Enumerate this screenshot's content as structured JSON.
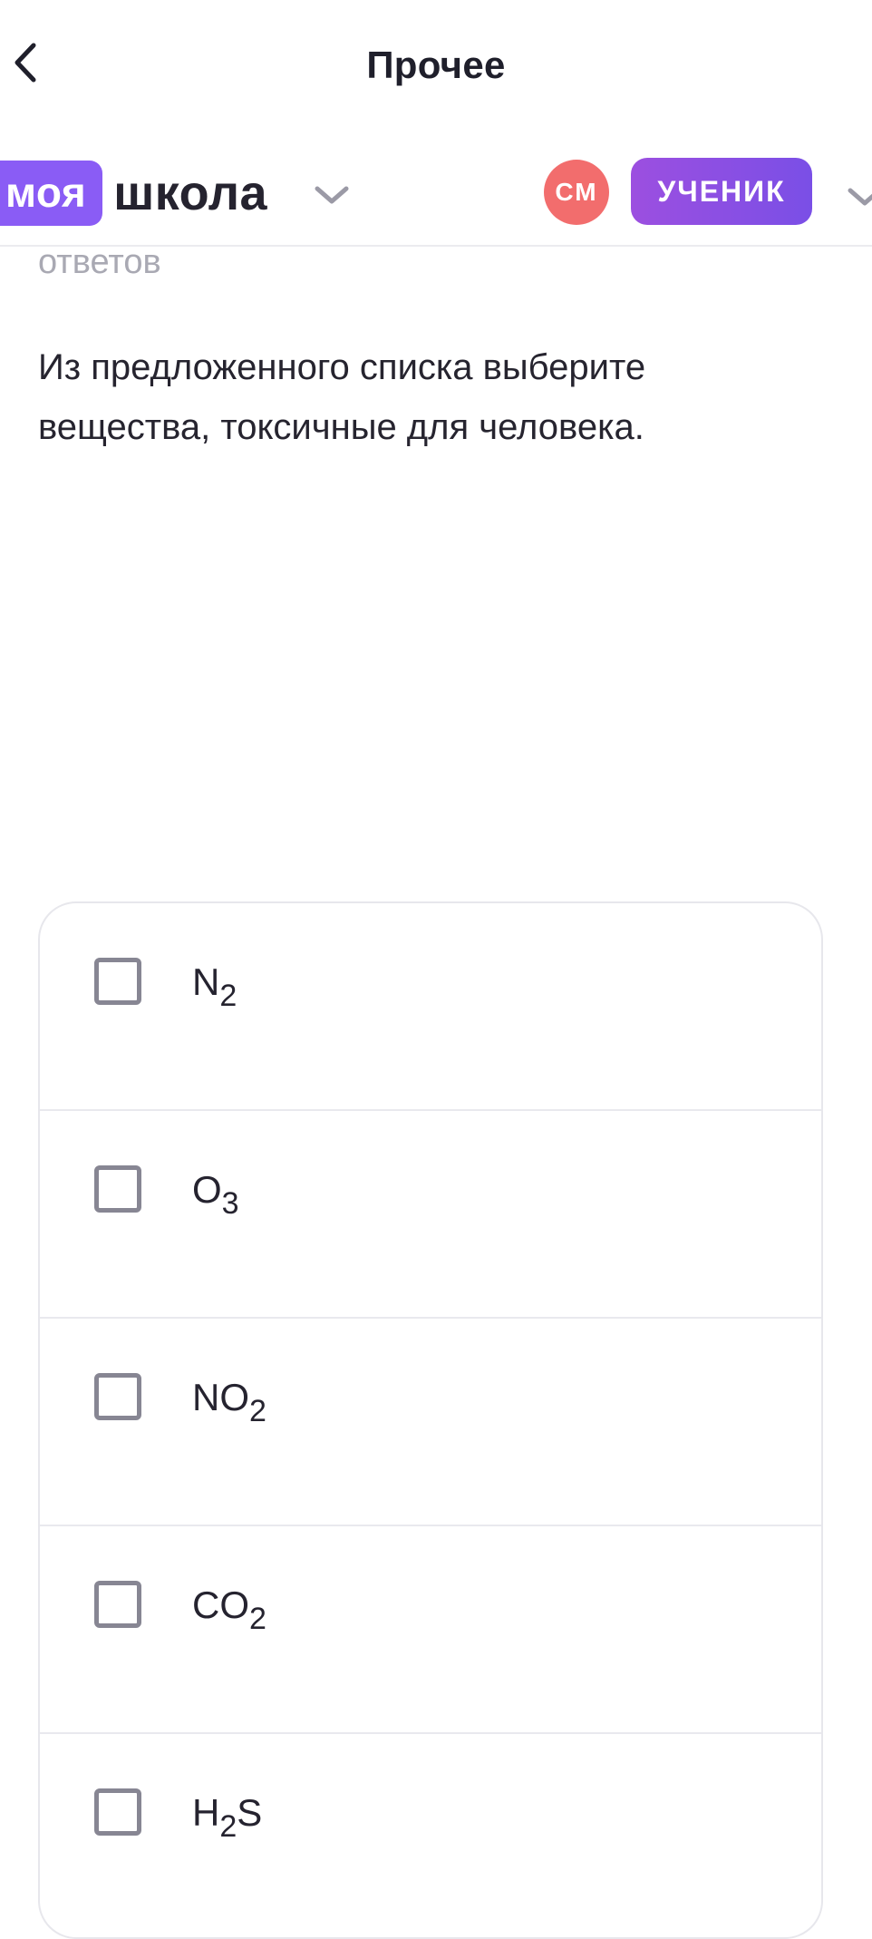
{
  "header": {
    "title": "Прочее"
  },
  "brandbar": {
    "brand_part1": "моя",
    "brand_part2": "школа",
    "avatar_initials": "СМ",
    "role": "УЧЕНИК"
  },
  "content": {
    "cut_label": "ответов",
    "question": "Из предложенного списка выберите вещества, токсичные для человека.",
    "options": [
      {
        "base": "N",
        "sub": "2",
        "tail": "",
        "checked": false
      },
      {
        "base": "O",
        "sub": "3",
        "tail": "",
        "checked": false
      },
      {
        "base": "NO",
        "sub": "2",
        "tail": "",
        "checked": false
      },
      {
        "base": "CO",
        "sub": "2",
        "tail": "",
        "checked": false
      },
      {
        "base": "H",
        "sub": "2",
        "tail": "S",
        "checked": false
      }
    ]
  },
  "colors": {
    "brand_purple": "#8a5cf5",
    "avatar_red": "#f26d6d",
    "role_gradient_start": "#9c4fe0",
    "role_gradient_end": "#7a4fe6",
    "checkbox_border": "#878693"
  }
}
